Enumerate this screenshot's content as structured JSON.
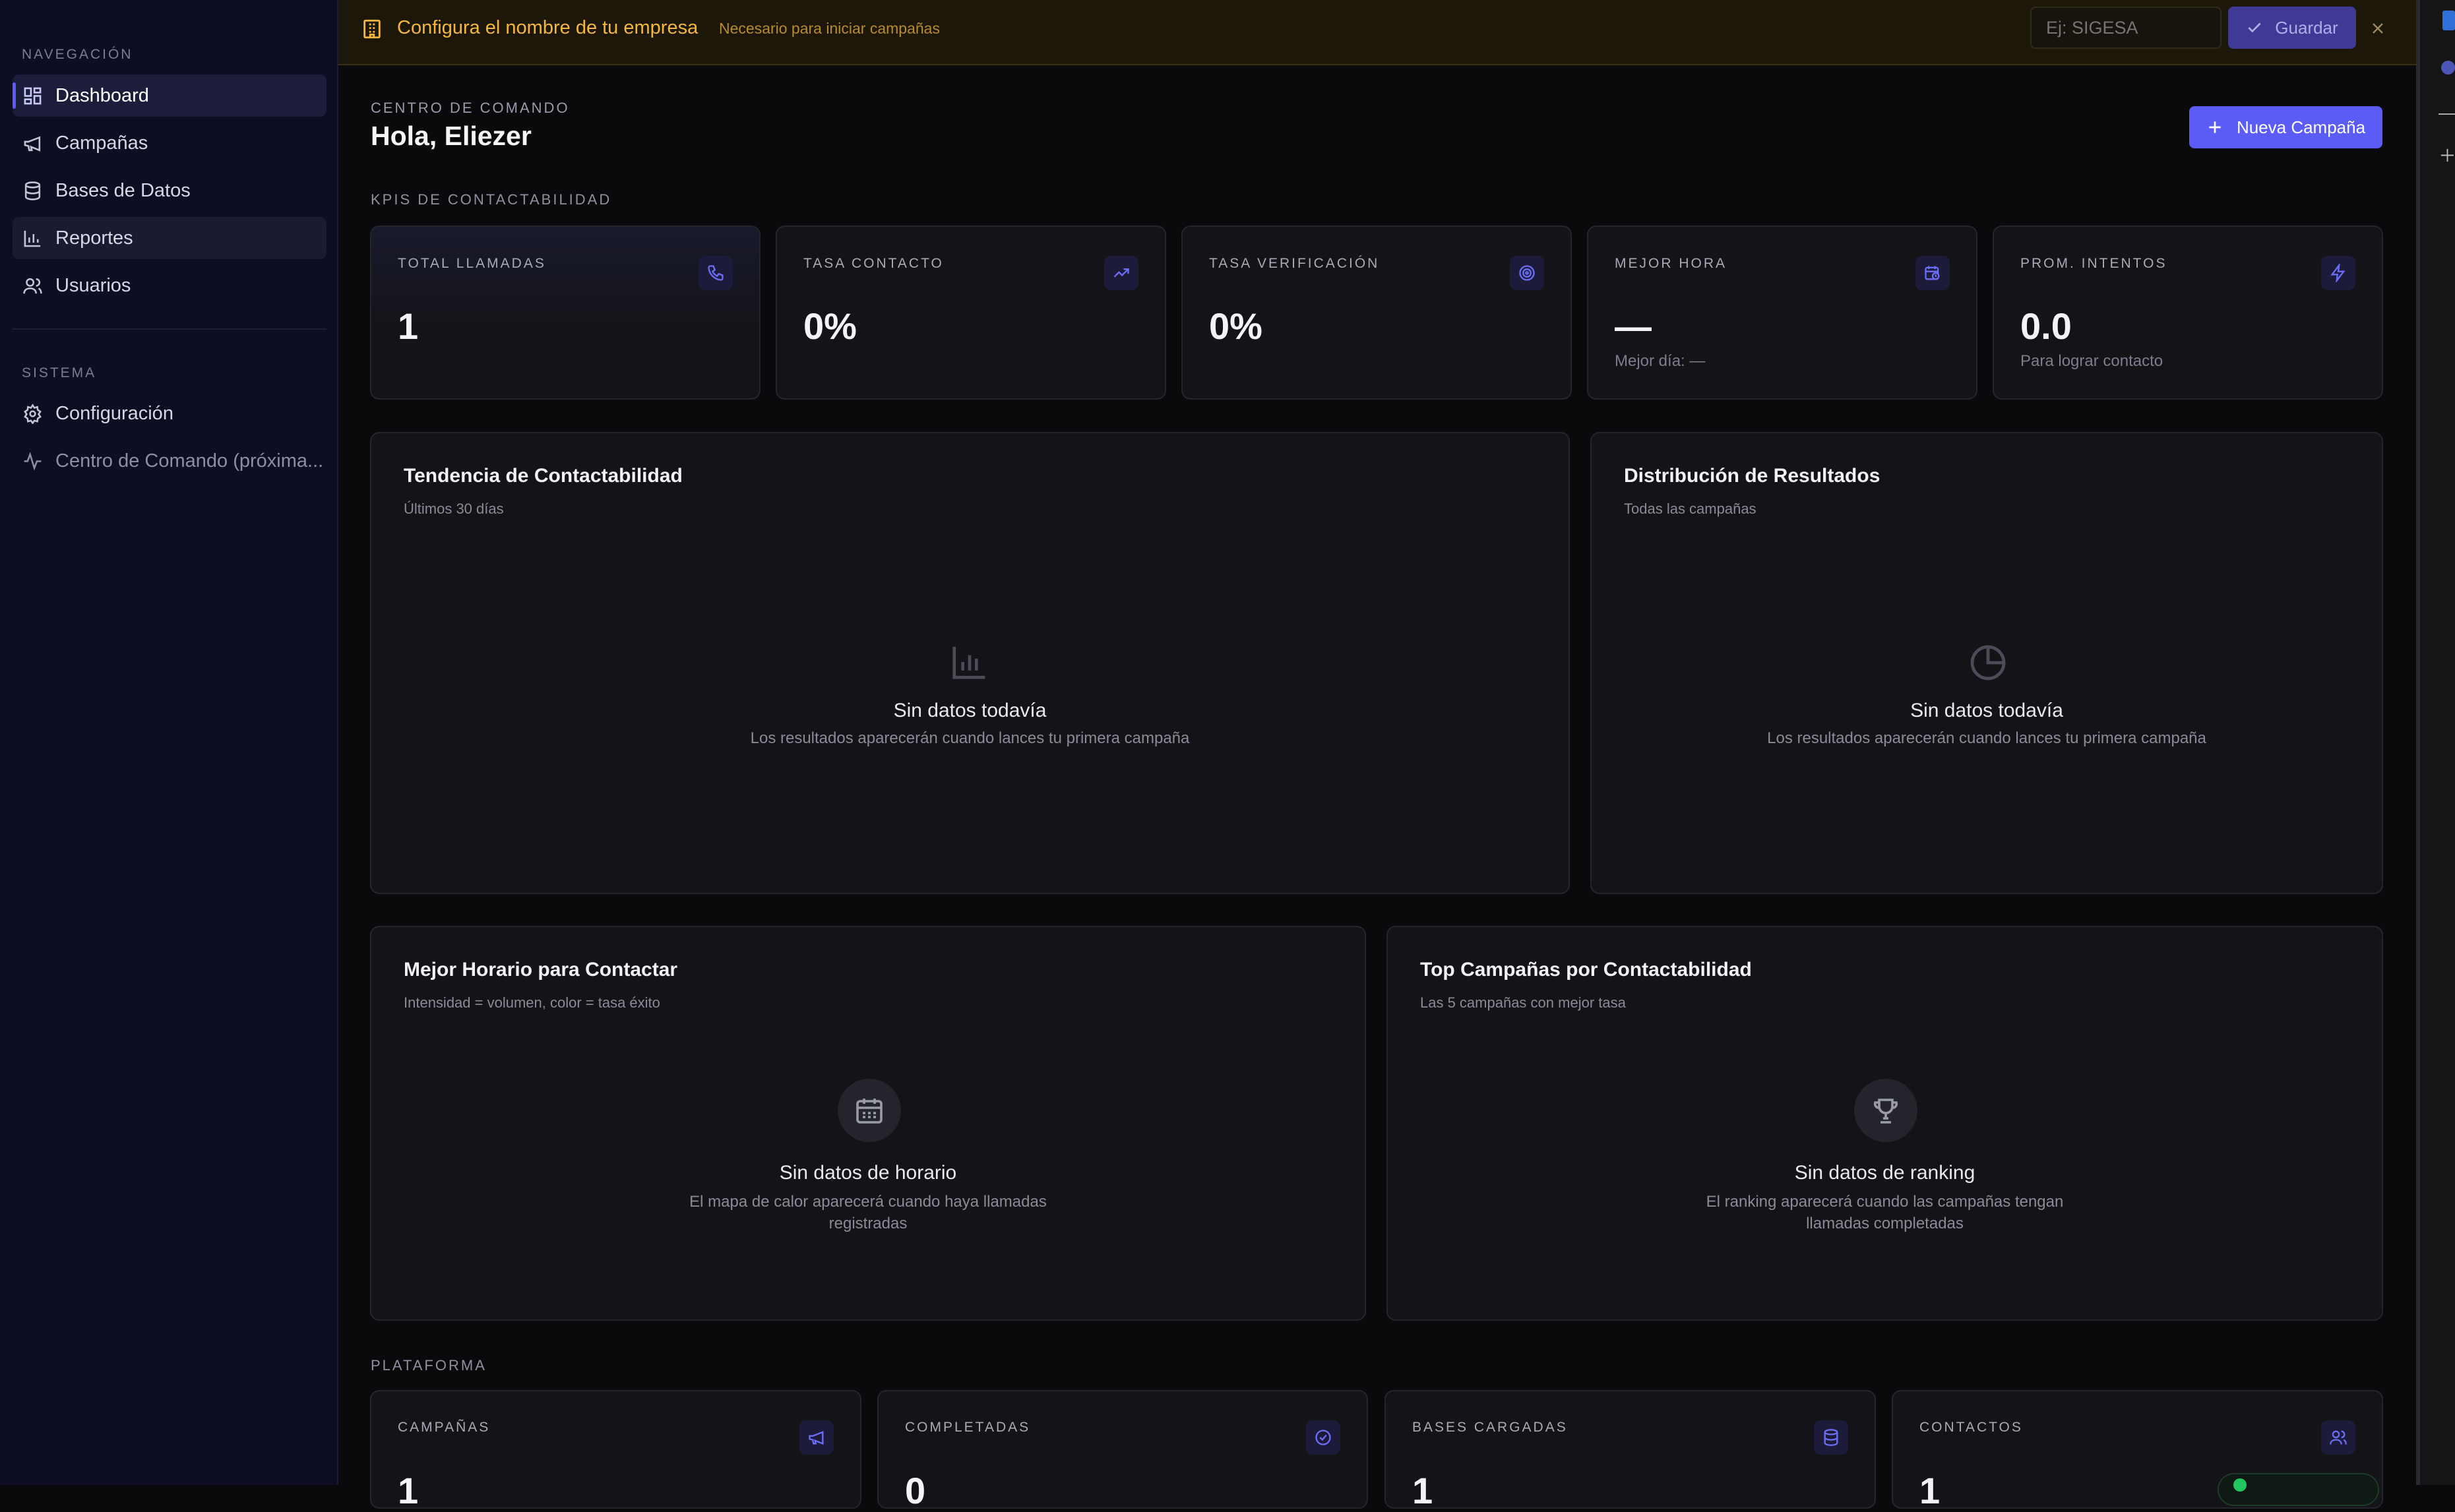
{
  "sidebar": {
    "nav_label": "NAVEGACIÓN",
    "nav_items": [
      {
        "label": "Dashboard",
        "icon": "dashboard-icon"
      },
      {
        "label": "Campañas",
        "icon": "megaphone-icon"
      },
      {
        "label": "Bases de Datos",
        "icon": "database-icon"
      },
      {
        "label": "Reportes",
        "icon": "bar-chart-icon"
      },
      {
        "label": "Usuarios",
        "icon": "users-icon"
      }
    ],
    "system_label": "SISTEMA",
    "system_items": [
      {
        "label": "Configuración",
        "icon": "gear-icon"
      },
      {
        "label": "Centro de Comando (próxima...",
        "icon": "activity-icon"
      }
    ]
  },
  "banner": {
    "title": "Configura el nombre de tu empresa",
    "subtitle": "Necesario para iniciar campañas",
    "input_placeholder": "Ej: SIGESA",
    "save_label": "Guardar"
  },
  "header": {
    "overline": "CENTRO DE COMANDO",
    "greeting": "Hola, Eliezer",
    "new_campaign_label": "Nueva Campaña"
  },
  "kpis": {
    "section_label": "KPIS DE CONTACTABILIDAD",
    "cards": [
      {
        "label": "TOTAL LLAMADAS",
        "value": "1",
        "sub": "",
        "icon": "phone-icon"
      },
      {
        "label": "TASA CONTACTO",
        "value": "0%",
        "sub": "",
        "icon": "trend-up-icon"
      },
      {
        "label": "TASA VERIFICACIÓN",
        "value": "0%",
        "sub": "",
        "icon": "target-icon"
      },
      {
        "label": "MEJOR HORA",
        "value": "—",
        "sub": "Mejor día: —",
        "icon": "calendar-clock-icon"
      },
      {
        "label": "PROM. INTENTOS",
        "value": "0.0",
        "sub": "Para lograr contacto",
        "icon": "lightning-icon"
      }
    ]
  },
  "charts": {
    "trend": {
      "title": "Tendencia de Contactabilidad",
      "subtitle": "Últimos 30 días",
      "empty_title": "Sin datos todavía",
      "empty_desc": "Los resultados aparecerán cuando lances tu primera campaña"
    },
    "distribution": {
      "title": "Distribución de Resultados",
      "subtitle": "Todas las campañas",
      "empty_title": "Sin datos todavía",
      "empty_desc": "Los resultados aparecerán cuando lances tu primera campaña"
    },
    "schedule": {
      "title": "Mejor Horario para Contactar",
      "subtitle": "Intensidad = volumen, color = tasa éxito",
      "empty_title": "Sin datos de horario",
      "empty_desc_1": "El mapa de calor aparecerá cuando haya llamadas",
      "empty_desc_2": "registradas"
    },
    "ranking": {
      "title": "Top Campañas por Contactabilidad",
      "subtitle": "Las 5 campañas con mejor tasa",
      "empty_title": "Sin datos de ranking",
      "empty_desc_1": "El ranking aparecerá cuando las campañas tengan",
      "empty_desc_2": "llamadas completadas"
    }
  },
  "platform": {
    "section_label": "PLATAFORMA",
    "cards": [
      {
        "label": "CAMPAÑAS",
        "value": "1",
        "icon": "megaphone-icon"
      },
      {
        "label": "COMPLETADAS",
        "value": "0",
        "icon": "check-circle-icon"
      },
      {
        "label": "BASES CARGADAS",
        "value": "1",
        "icon": "database-icon"
      },
      {
        "label": "CONTACTOS",
        "value": "1",
        "icon": "users-icon"
      }
    ]
  },
  "colors": {
    "accent": "#5b5cf6",
    "banner_text": "#f5b73b",
    "background": "#0a0a0d",
    "sidebar": "#0d0e23"
  }
}
